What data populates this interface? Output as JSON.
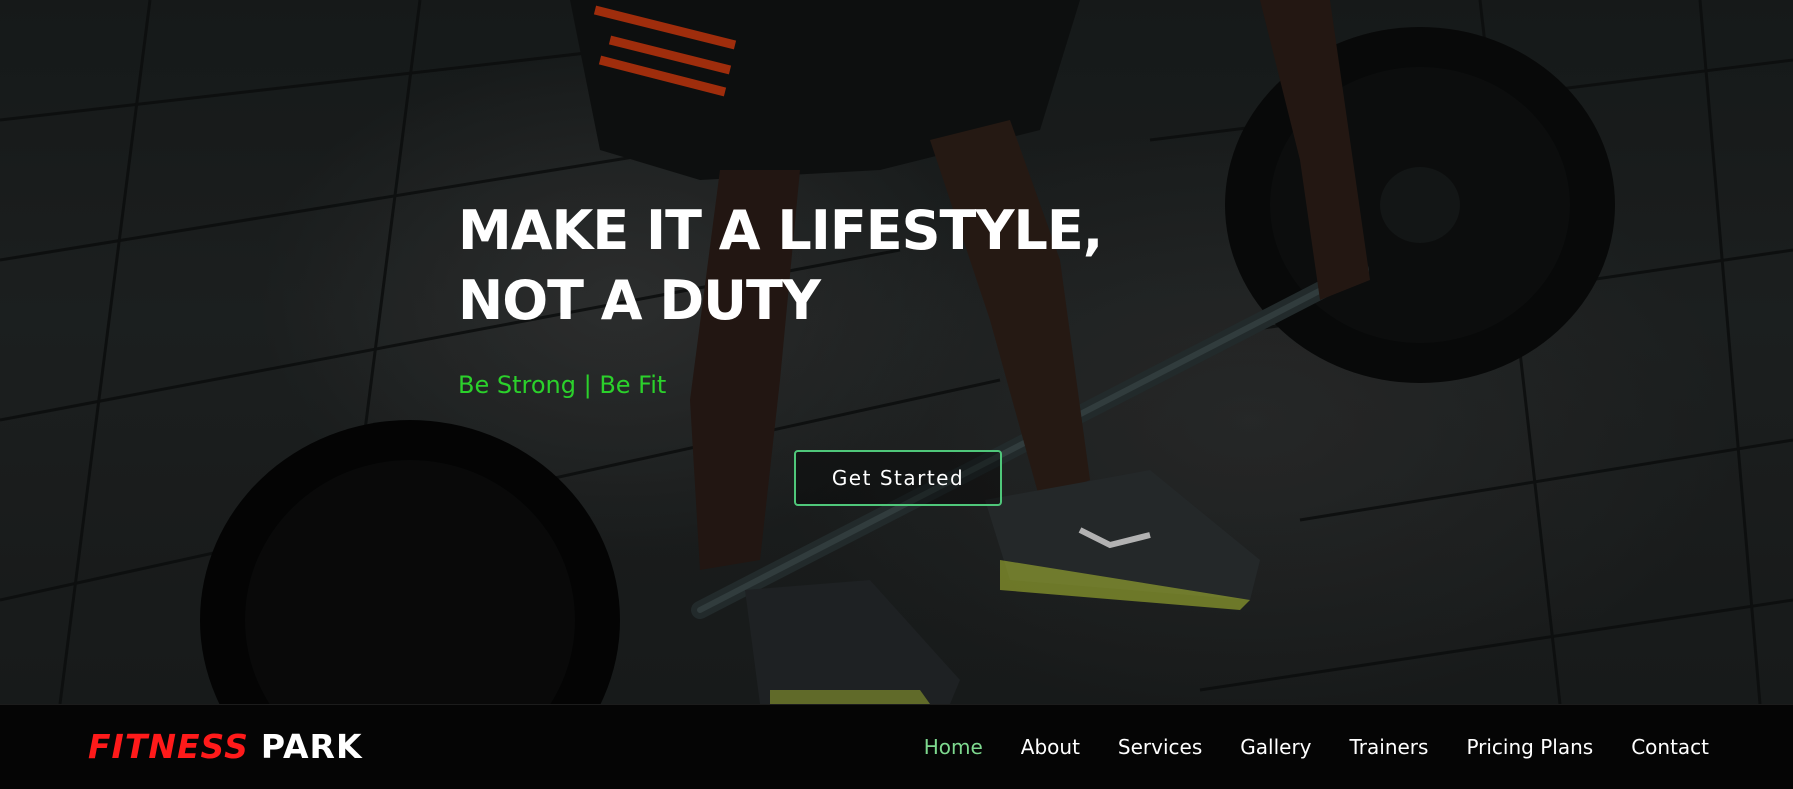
{
  "hero": {
    "title_line1": "MAKE IT A LIFESTYLE,",
    "title_line2": "NOT A DUTY",
    "tagline": "Be Strong | Be Fit",
    "cta_label": "Get Started",
    "background": "weightlifter-barbell-photo"
  },
  "navbar": {
    "brand_accent": "FITNESS",
    "brand_rest": "PARK",
    "items": [
      {
        "label": "Home",
        "active": true
      },
      {
        "label": "About",
        "active": false
      },
      {
        "label": "Services",
        "active": false
      },
      {
        "label": "Gallery",
        "active": false
      },
      {
        "label": "Trainers",
        "active": false
      },
      {
        "label": "Pricing Plans",
        "active": false
      },
      {
        "label": "Contact",
        "active": false
      }
    ]
  },
  "colors": {
    "brand_accent": "#ff1a1a",
    "tagline": "#2bd12b",
    "active_nav": "#7ed98f",
    "cta_border": "#4fc77a",
    "navbar_bg": "#050505"
  }
}
